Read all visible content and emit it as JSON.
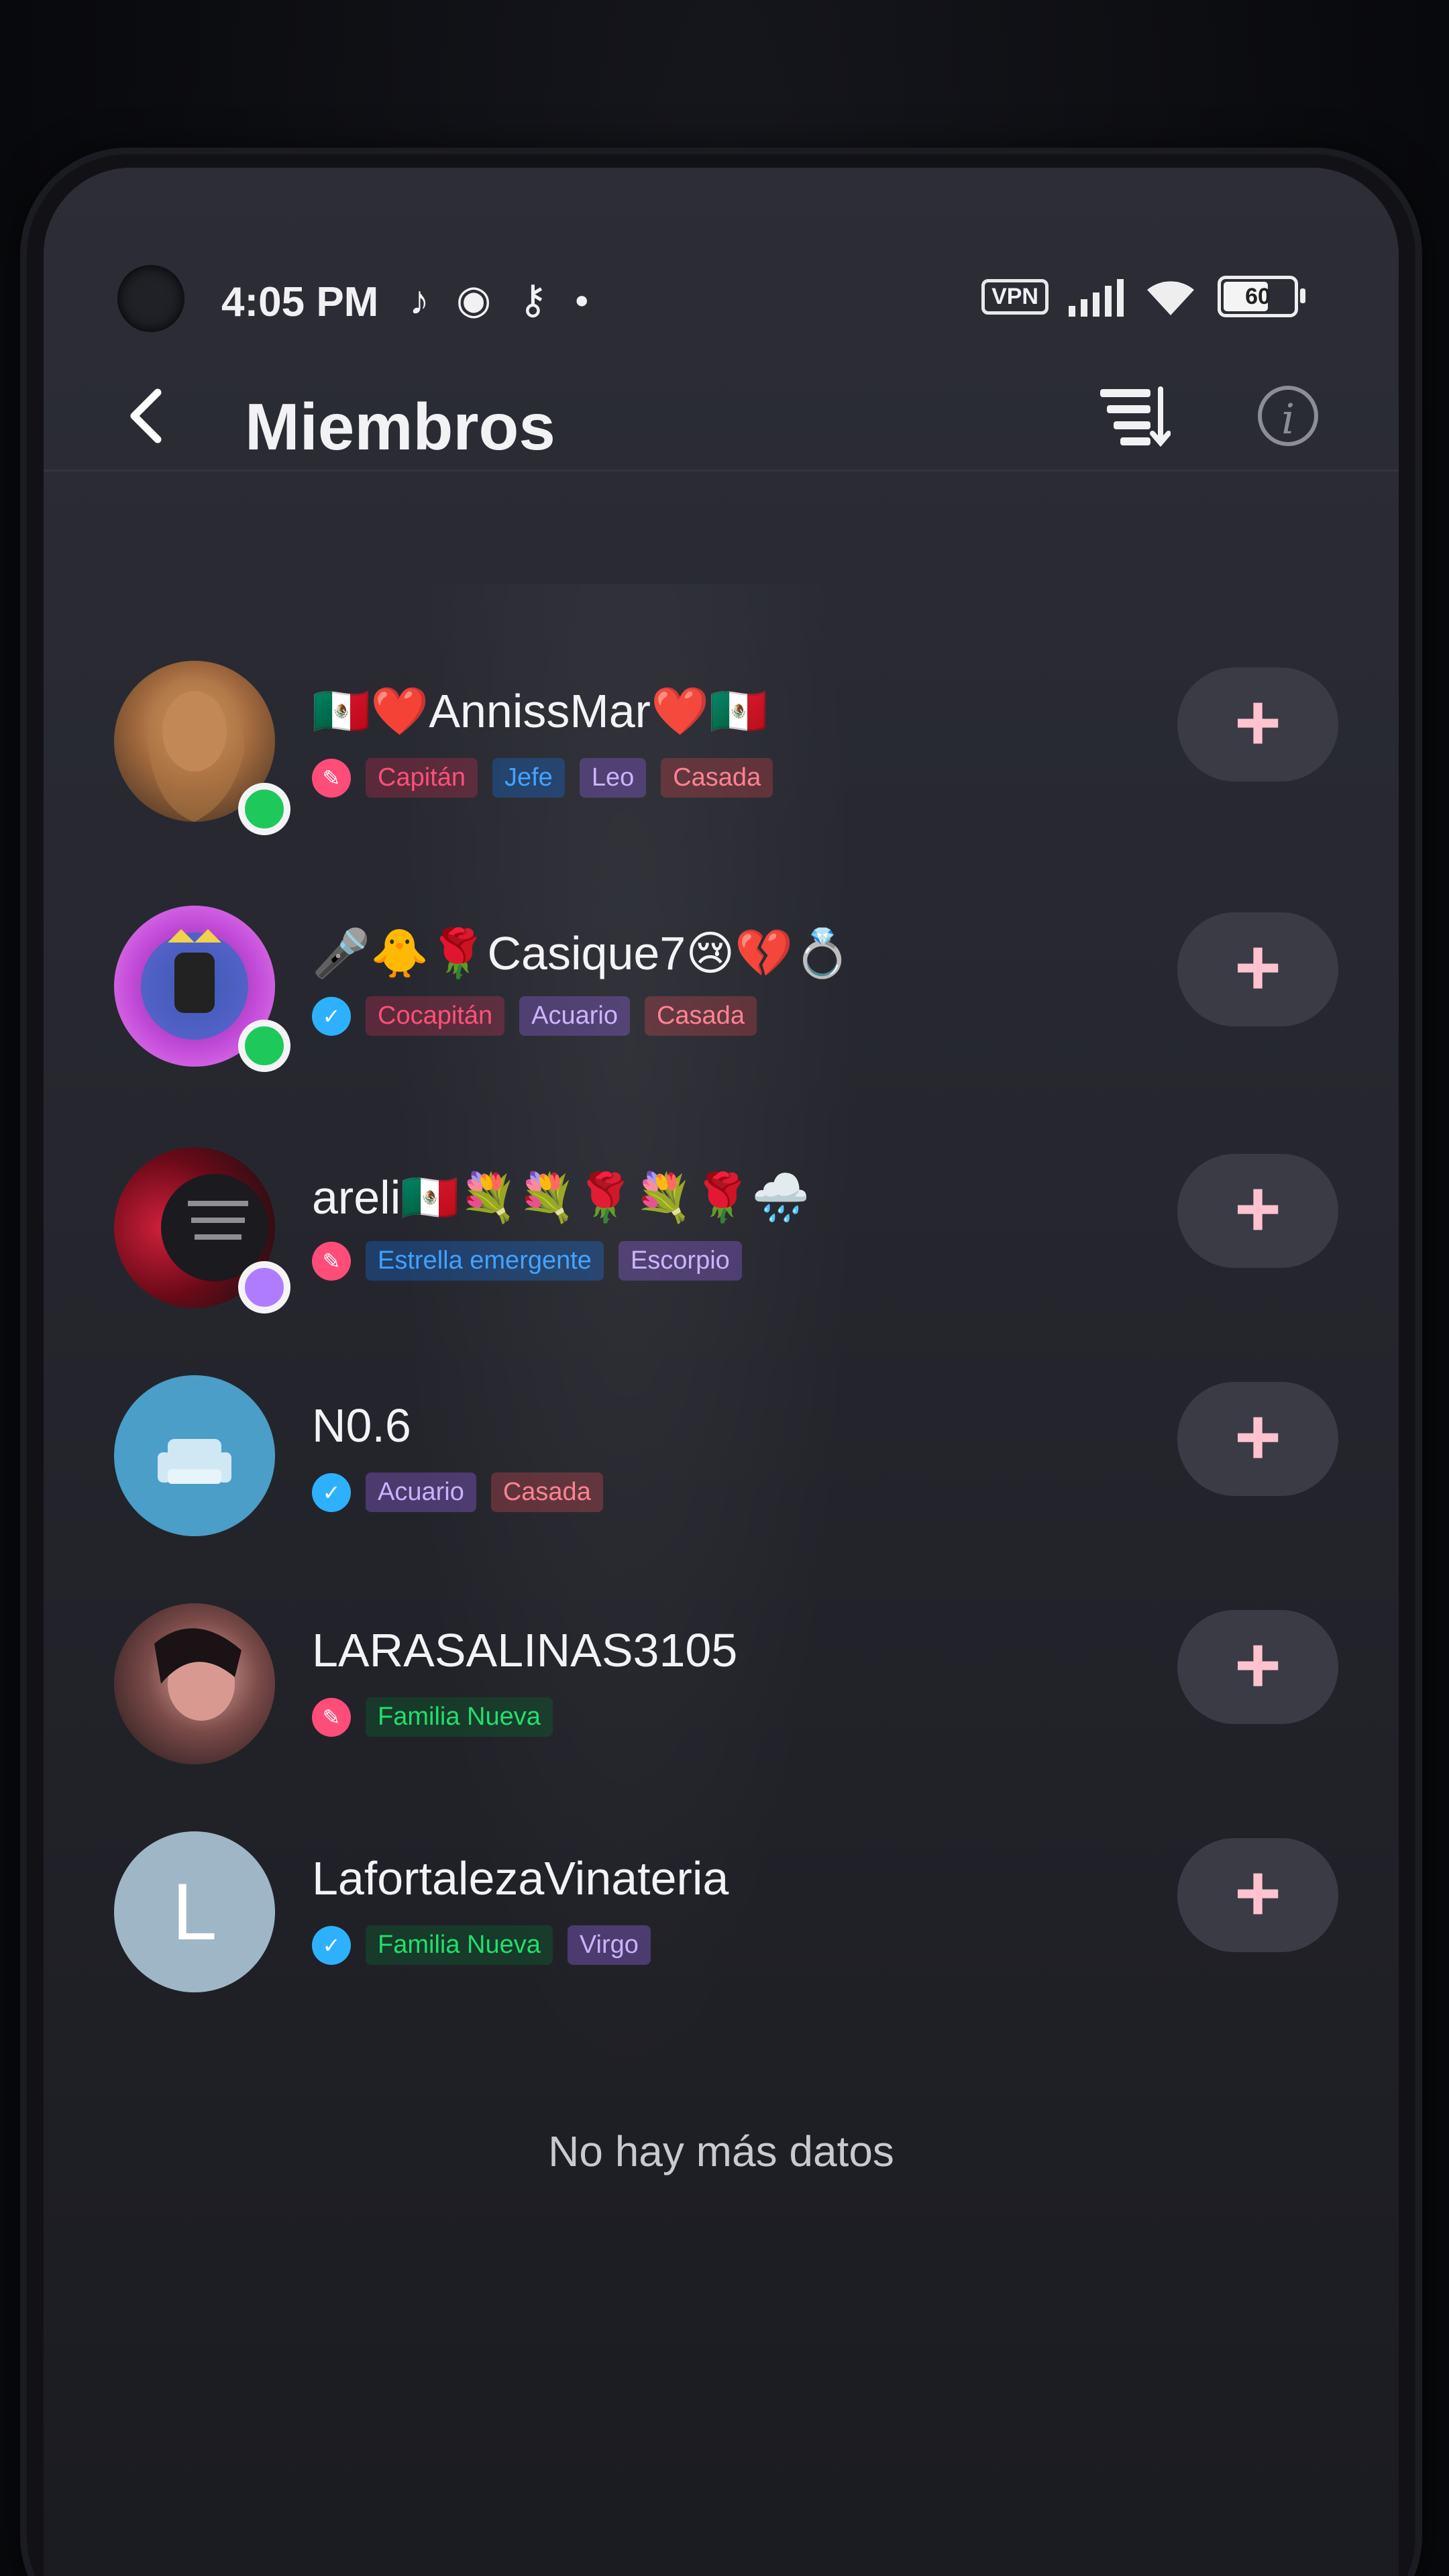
{
  "status_bar": {
    "time": "4:05 PM",
    "vpn": "VPN",
    "battery": "60",
    "icons": [
      "tiktok-icon",
      "chrome-icon",
      "key-icon",
      "dot-icon",
      "signal-icon",
      "wifi-icon",
      "battery-icon"
    ]
  },
  "header": {
    "title": "Miembros",
    "back_icon": "chevron-left-icon",
    "sort_icon": "sort-icon",
    "info_icon": "info-icon",
    "info_glyph": "i"
  },
  "members": [
    {
      "name": "🇲🇽❤️AnnissMar❤️🇲🇽",
      "status_color": "#1ec85a",
      "level_color": "#ff4d7a",
      "badges": [
        {
          "label": "Capitán",
          "bg": "#5a2a3a",
          "color": "#ff4f77"
        },
        {
          "label": "Jefe",
          "bg": "#1f3f6a",
          "color": "#3fa1ff"
        },
        {
          "label": "Leo",
          "bg": "#4a3a6e",
          "color": "#c8b2ff"
        },
        {
          "label": "Casada",
          "bg": "#5e3038",
          "color": "#ff7f8e"
        }
      ],
      "add_label": "+"
    },
    {
      "name": "🎤🐥🌹Casique7😢💔💍",
      "status_color": "#1ec85a",
      "level_color": "#2db1ff",
      "badges": [
        {
          "label": "Cocapitán",
          "bg": "#5a2a3a",
          "color": "#ff4f77"
        },
        {
          "label": "Acuario",
          "bg": "#4a3a6e",
          "color": "#c8b2ff"
        },
        {
          "label": "Casada",
          "bg": "#5e3038",
          "color": "#ff7f8e"
        }
      ],
      "add_label": "+"
    },
    {
      "name": "areli🇲🇽💐💐🌹💐🌹🌧️",
      "status_color": "#b07cff",
      "level_color": "#ff4d7a",
      "badges": [
        {
          "label": "Estrella emergente",
          "bg": "#1f3f6a",
          "color": "#3fa1ff"
        },
        {
          "label": "Escorpio",
          "bg": "#4a3a6e",
          "color": "#c8b2ff"
        }
      ],
      "add_label": "+"
    },
    {
      "name": "N0.6",
      "status_color": "",
      "level_color": "#2db1ff",
      "badges": [
        {
          "label": "Acuario",
          "bg": "#4a3a6e",
          "color": "#c8b2ff"
        },
        {
          "label": "Casada",
          "bg": "#5e3038",
          "color": "#ff7f8e"
        }
      ],
      "add_label": "+"
    },
    {
      "name": "LARASALINAS3105",
      "status_color": "",
      "level_color": "#ff4d7a",
      "badges": [
        {
          "label": "Familia Nueva",
          "bg": "#173a2a",
          "color": "#1fe06a"
        }
      ],
      "add_label": "+"
    },
    {
      "name": "LafortalezaVinateria",
      "status_color": "",
      "level_color": "#2db1ff",
      "avatar_letter": "L",
      "badges": [
        {
          "label": "Familia Nueva",
          "bg": "#173a2a",
          "color": "#1fe06a"
        },
        {
          "label": "Virgo",
          "bg": "#4a3a6e",
          "color": "#c8b2ff"
        }
      ],
      "add_label": "+"
    }
  ],
  "footer": {
    "no_more": "No hay más datos"
  }
}
